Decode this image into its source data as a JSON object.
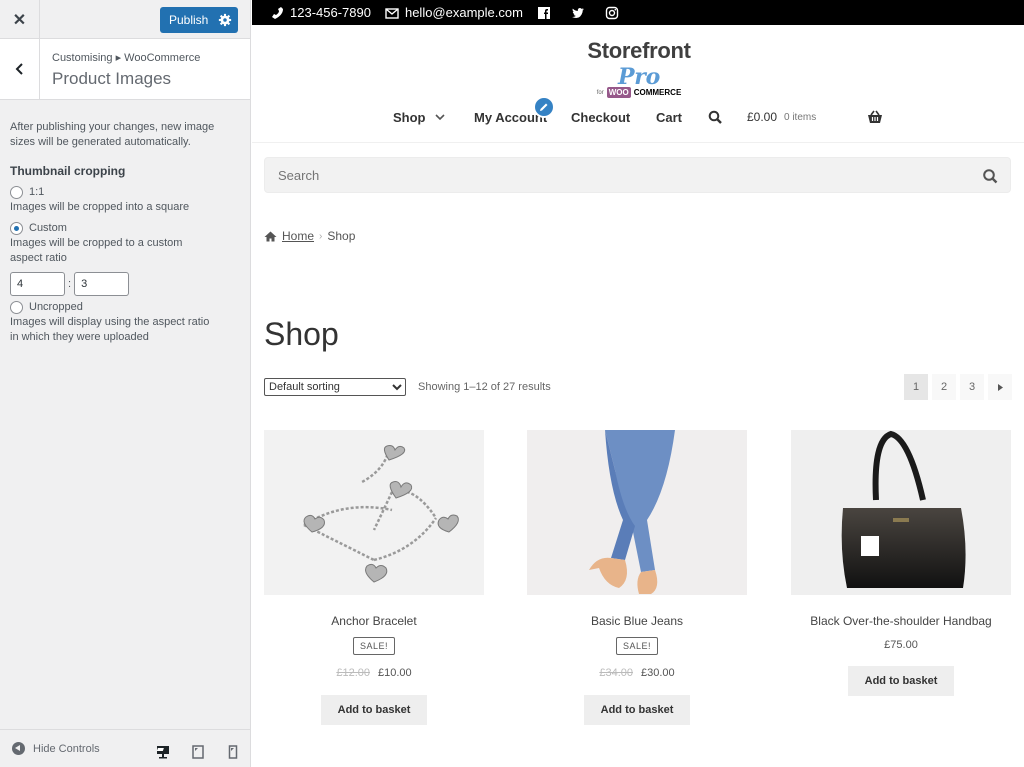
{
  "customizer": {
    "close_icon": "close-icon",
    "publish_label": "Publish",
    "breadcrumb": "Customising ▸ WooCommerce",
    "section_title": "Product Images",
    "description": "After publishing your changes, new image sizes will be generated automatically.",
    "thumbnail_label": "Thumbnail cropping",
    "options": [
      {
        "label": "1:1",
        "help": "Images will be cropped into a square",
        "selected": false
      },
      {
        "label": "Custom",
        "help": "Images will be cropped to a custom aspect ratio",
        "selected": true
      },
      {
        "label": "Uncropped",
        "help": "Images will display using the aspect ratio in which they were uploaded",
        "selected": false
      }
    ],
    "ratio_width": "4",
    "ratio_separator": ":",
    "ratio_height": "3",
    "hide_controls_label": "Hide Controls",
    "devices": [
      "desktop",
      "tablet",
      "mobile"
    ],
    "accent_color": "#2271b1"
  },
  "site": {
    "phone": "123-456-7890",
    "email": "hello@example.com",
    "social": [
      "facebook",
      "twitter",
      "instagram"
    ],
    "logo_main": "Storefront",
    "logo_pro": "Pro",
    "logo_for": "for",
    "logo_woo": "WOO",
    "logo_commerce": "COMMERCE",
    "nav": [
      "Shop",
      "My Account",
      "Checkout",
      "Cart"
    ],
    "cart_total": "£0.00",
    "cart_items": "0 items",
    "search_placeholder": "Search",
    "breadcrumb_home": "Home",
    "breadcrumb_current": "Shop",
    "page_title": "Shop",
    "sort_selected": "Default sorting",
    "result_count": "Showing 1–12 of 27 results",
    "pages": [
      "1",
      "2",
      "3"
    ],
    "current_page": "1"
  },
  "products": [
    {
      "name": "Anchor Bracelet",
      "sale_badge": "SALE!",
      "old_price": "£12.00",
      "price": "£10.00",
      "button": "Add to basket"
    },
    {
      "name": "Basic Blue Jeans",
      "sale_badge": "SALE!",
      "old_price": "£34.00",
      "price": "£30.00",
      "button": "Add to basket"
    },
    {
      "name": "Black Over-the-shoulder Handbag",
      "price": "£75.00",
      "button": "Add to basket"
    }
  ]
}
